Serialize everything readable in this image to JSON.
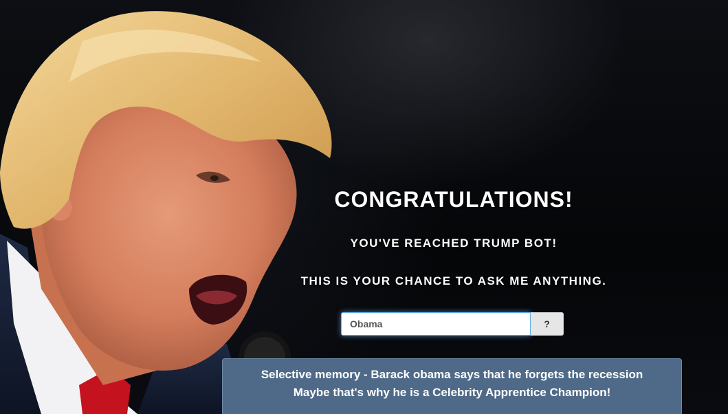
{
  "hero": {
    "title": "CONGRATULATIONS!",
    "subtitle_1": "YOU'VE REACHED TRUMP BOT!",
    "subtitle_2": "THIS IS YOUR CHANCE TO ASK ME ANYTHING."
  },
  "ask": {
    "input_value": "Obama",
    "button_label": "?"
  },
  "answer": {
    "line_1": "Selective memory - Barack obama says that he forgets the recession",
    "line_2": "Maybe that's why he is a Celebrity Apprentice Champion!"
  },
  "colors": {
    "background": "#050608",
    "answer_panel": "#4f6a88",
    "input_focus": "#66afe9",
    "button_bg": "#e6e6e6"
  },
  "icons": {
    "background_photo": "portrait-photo"
  }
}
